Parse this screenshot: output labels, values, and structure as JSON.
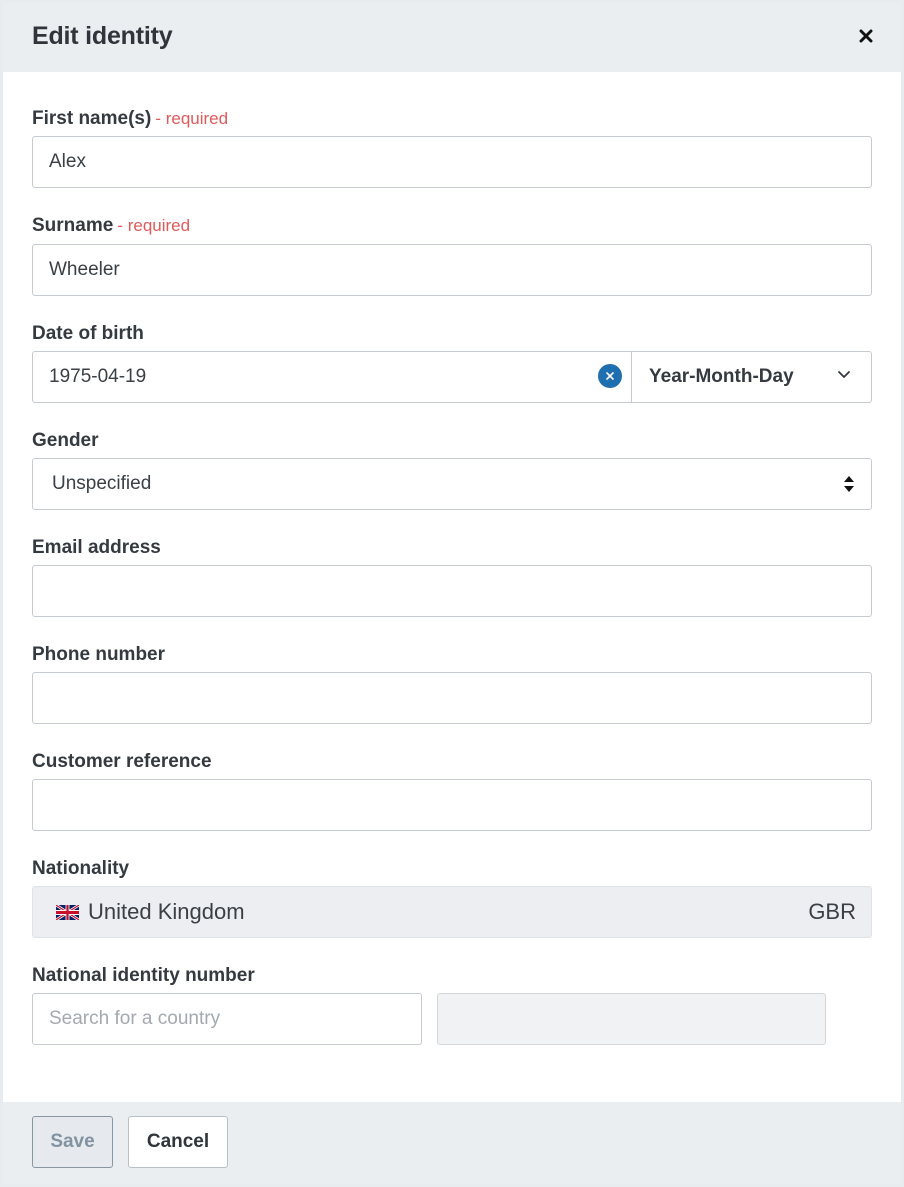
{
  "modal": {
    "title": "Edit identity",
    "close_icon": "close-icon"
  },
  "form": {
    "first_name": {
      "label": "First name(s)",
      "required_text": "- required",
      "value": "Alex"
    },
    "surname": {
      "label": "Surname",
      "required_text": "- required",
      "value": "Wheeler"
    },
    "dob": {
      "label": "Date of birth",
      "value": "1975-04-19",
      "clear_icon": "clear-circle-icon",
      "format": "Year-Month-Day",
      "format_icon": "chevron-down-icon"
    },
    "gender": {
      "label": "Gender",
      "value": "Unspecified",
      "icon": "sort-arrows-icon"
    },
    "email": {
      "label": "Email address",
      "value": ""
    },
    "phone": {
      "label": "Phone number",
      "value": ""
    },
    "customer_reference": {
      "label": "Customer reference",
      "value": ""
    },
    "nationality": {
      "label": "Nationality",
      "flag_icon": "uk-flag-icon",
      "country": "United Kingdom",
      "code": "GBR"
    },
    "national_id": {
      "label": "National identity number",
      "country_placeholder": "Search for a country",
      "number_value": ""
    }
  },
  "footer": {
    "save_label": "Save",
    "cancel_label": "Cancel"
  },
  "colors": {
    "header_bg": "#ebeef1",
    "required": "#e05a5a",
    "clear_button": "#1f6fb0",
    "disabled_bg": "#eceef1"
  }
}
